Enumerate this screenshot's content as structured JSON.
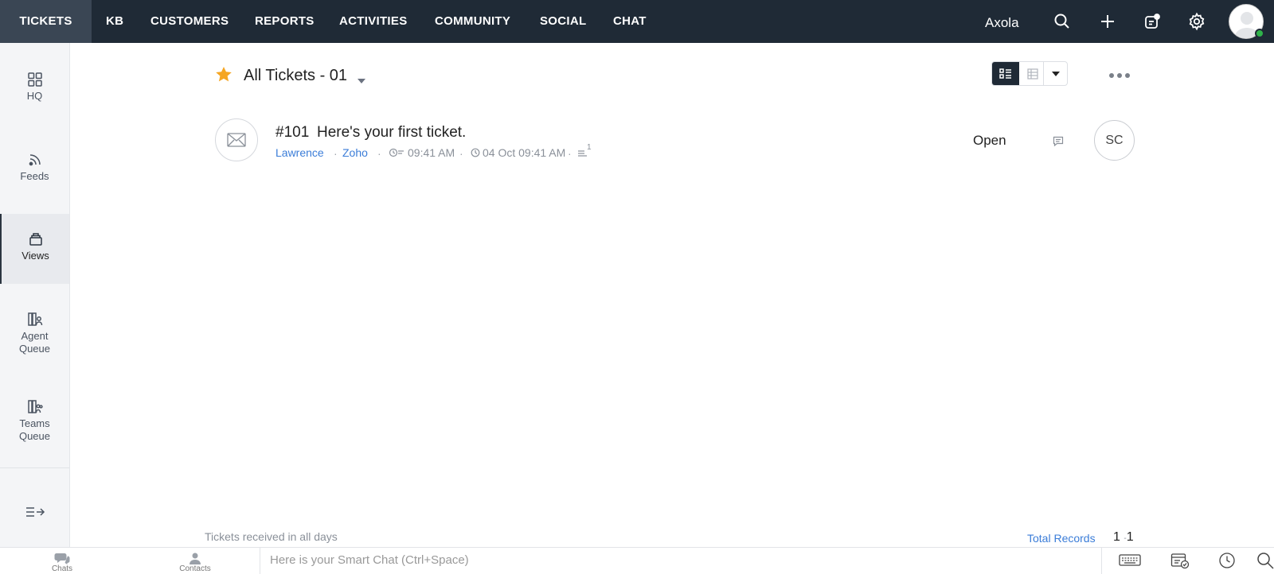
{
  "topnav": {
    "items": [
      "TICKETS",
      "KB",
      "CUSTOMERS",
      "REPORTS",
      "ACTIVITIES",
      "COMMUNITY",
      "SOCIAL",
      "CHAT"
    ],
    "active": "TICKETS",
    "portal_name": "Axola"
  },
  "sidebar": {
    "items": [
      {
        "label_line1": "HQ",
        "label_line2": "",
        "icon": "grid-icon"
      },
      {
        "label_line1": "Feeds",
        "label_line2": "",
        "icon": "feeds-icon"
      },
      {
        "label_line1": "Views",
        "label_line2": "",
        "icon": "views-icon"
      },
      {
        "label_line1": "Agent",
        "label_line2": "Queue",
        "icon": "agent-queue-icon"
      },
      {
        "label_line1": "Teams",
        "label_line2": "Queue",
        "icon": "teams-queue-icon"
      }
    ],
    "active": "Views"
  },
  "view": {
    "title": "All Tickets - 01"
  },
  "ticket": {
    "number": "#101",
    "subject": "Here's your first ticket.",
    "contact": "Lawrence",
    "account": "Zoho",
    "response_time": "09:41 AM",
    "created": "04 Oct 09:41 AM",
    "thread_count": "1",
    "status": "Open",
    "assignee_initials": "SC"
  },
  "footer": {
    "filter_text": "Tickets received in all days",
    "total_label": "Total Records",
    "range_start": "1",
    "range_sep": "-",
    "range_end": "1"
  },
  "bottombar": {
    "chats_label": "Chats",
    "contacts_label": "Contacts",
    "smartchat_placeholder": "Here is your Smart Chat (Ctrl+Space)"
  },
  "colors": {
    "topbar": "#1f2a36",
    "link": "#3b7dd8",
    "star": "#f5a623",
    "online": "#2fb34a"
  }
}
